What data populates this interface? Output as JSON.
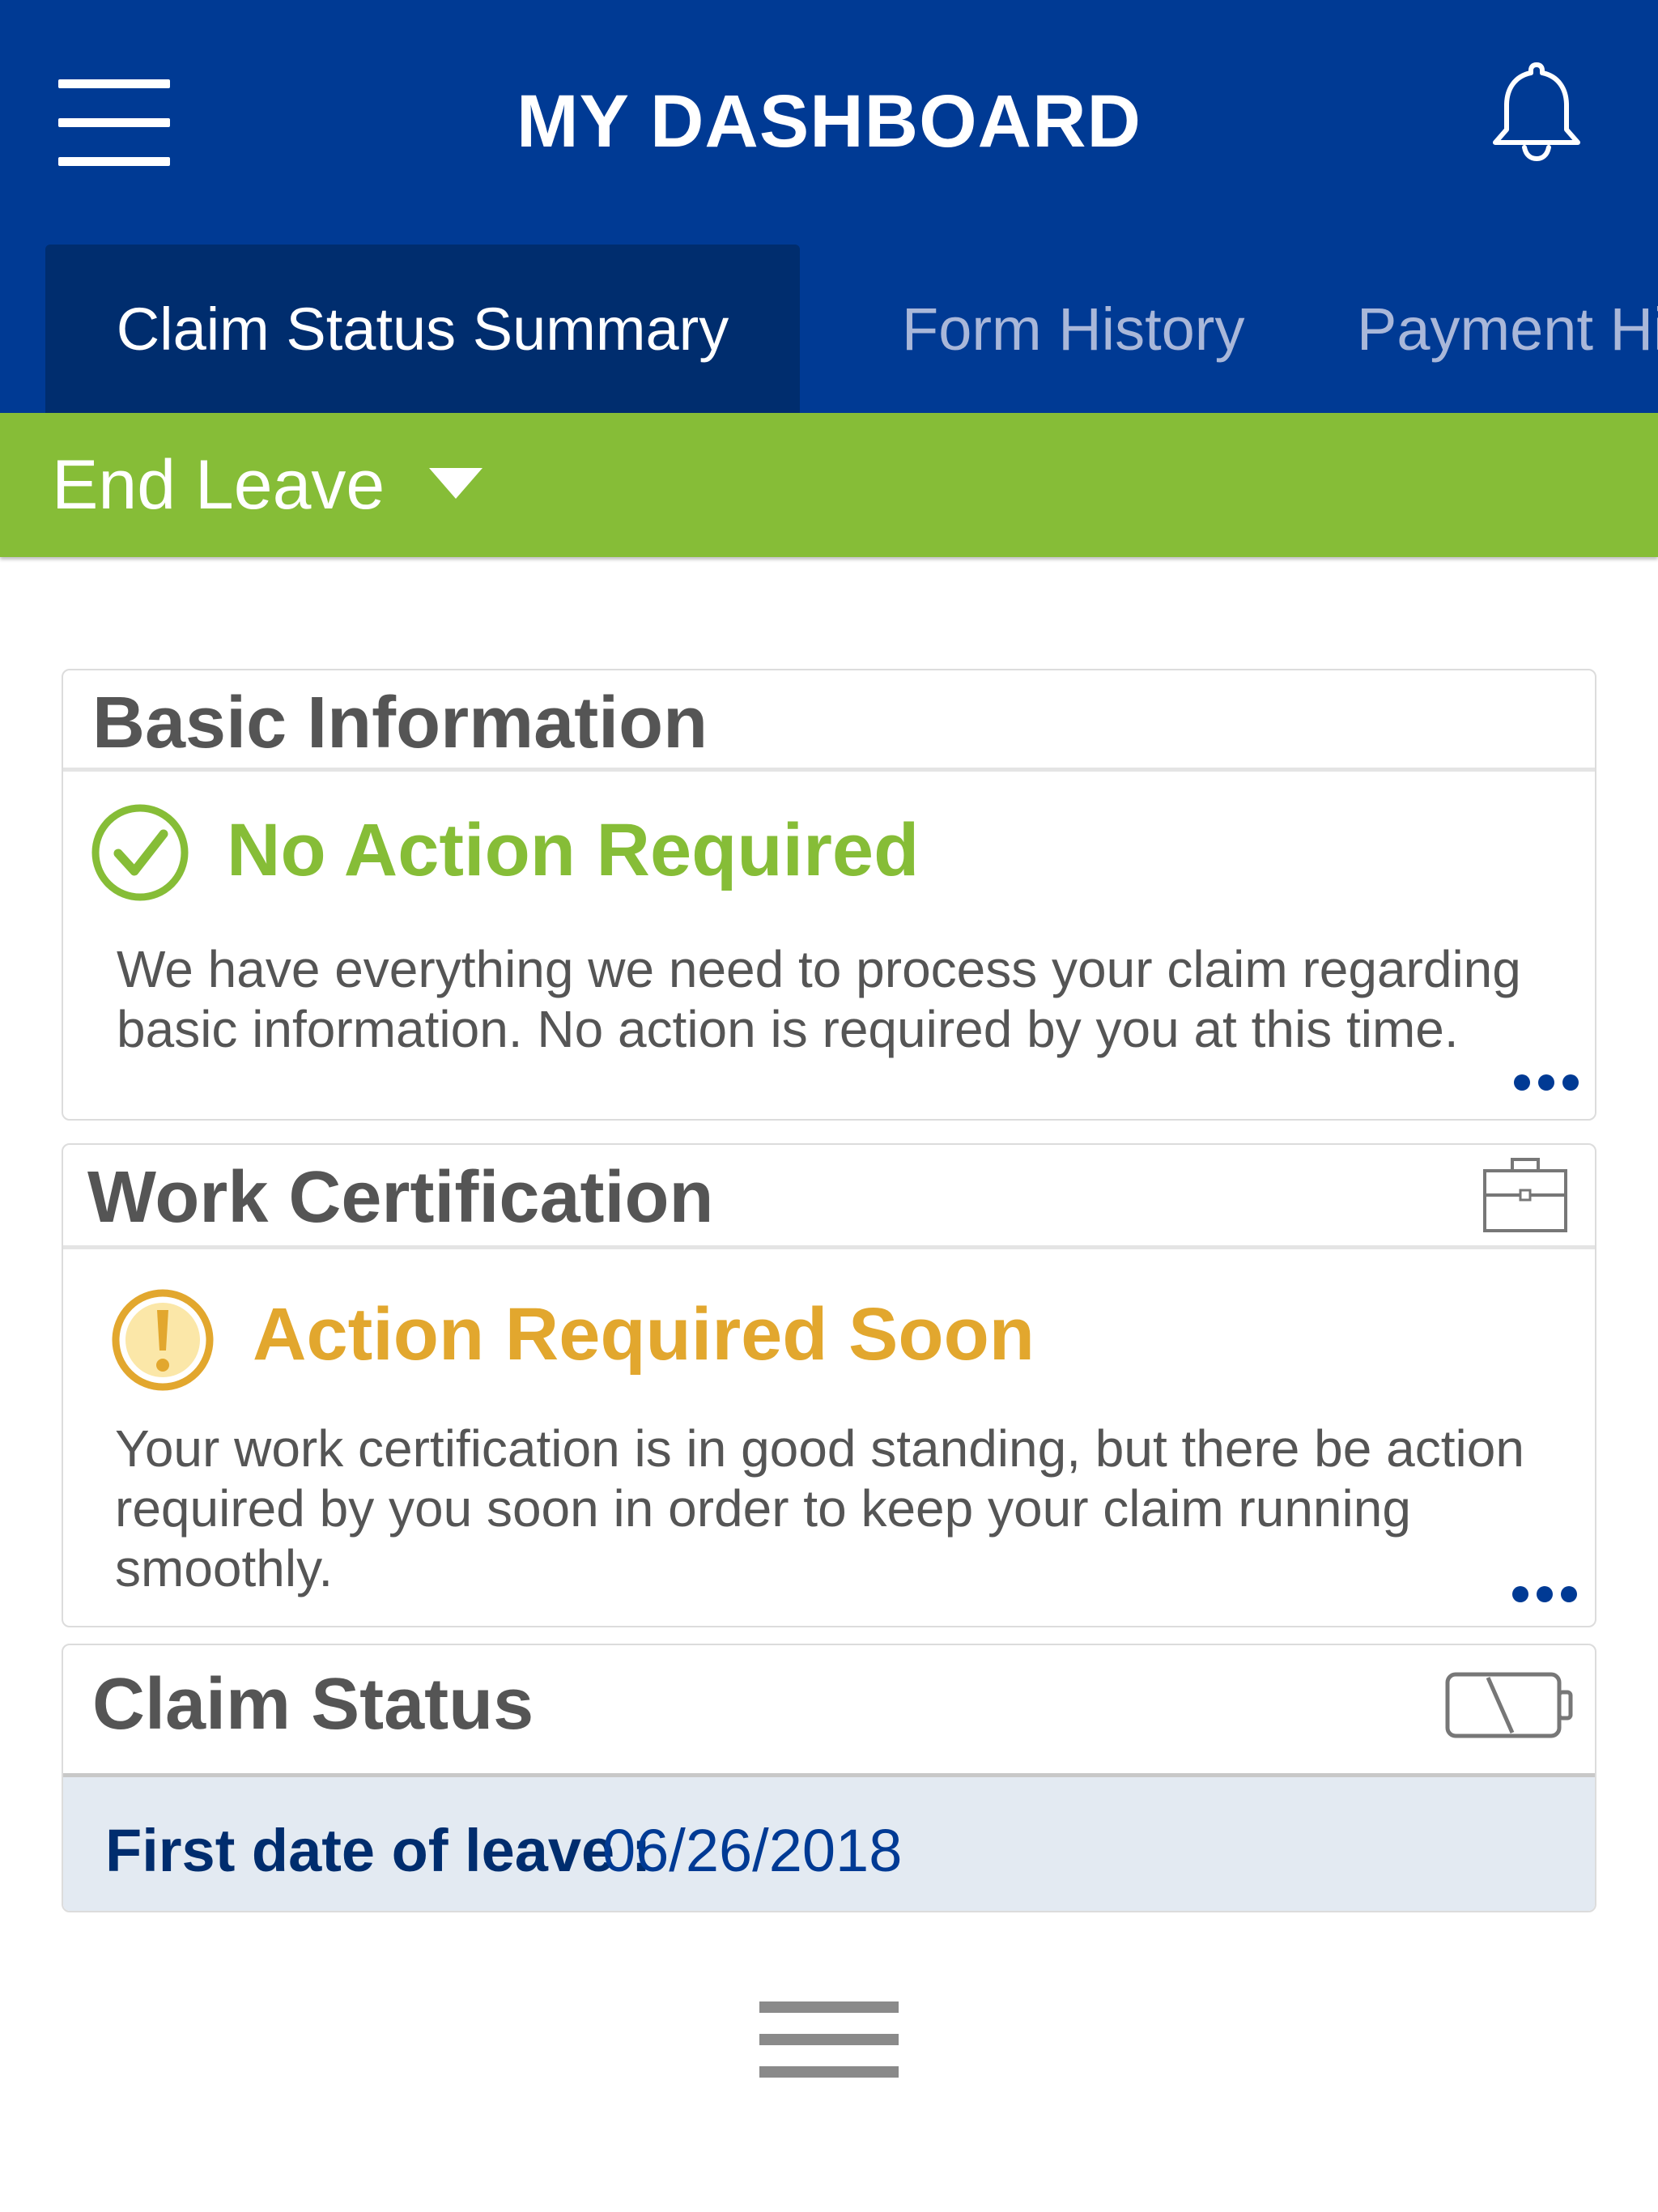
{
  "header": {
    "title": "MY DASHBOARD",
    "menu_icon": "hamburger-menu-icon",
    "notification_icon": "bell-icon",
    "background_color": "#003a94"
  },
  "tabs": [
    {
      "label": "Claim Status Summary",
      "active": true
    },
    {
      "label": "Form History",
      "active": false
    },
    {
      "label": "Payment His",
      "active": false
    }
  ],
  "leave_selector": {
    "label": "End Leave",
    "icon": "triangle-down-icon",
    "color": "#86bd37"
  },
  "cards": {
    "basic_information": {
      "title": "Basic Information",
      "status_icon": "check-circle-icon",
      "status": "No Action Required",
      "status_color": "#86bd37",
      "description_line1": "We have everything we need to process your claim regarding",
      "description_line2": "basic information. No action is required by you at this time.",
      "more_icon": "more-dots-icon"
    },
    "work_certification": {
      "title": "Work Certification",
      "header_icon": "briefcase-icon",
      "status_icon": "exclamation-circle-icon",
      "status": "Action Required Soon",
      "status_color": "#e2a72e",
      "description_line1": "Your work certification is in good standing, but there be action",
      "description_line2": "required by you soon in order to keep your claim running",
      "description_line3": "smoothly.",
      "more_icon": "more-dots-icon"
    },
    "claim_status": {
      "title": "Claim Status",
      "header_icon": "battery-icon",
      "first_leave_label": "First date of leave :",
      "first_leave_value": "06/26/2018"
    }
  },
  "bottom_handle_icon": "drag-handle-icon"
}
